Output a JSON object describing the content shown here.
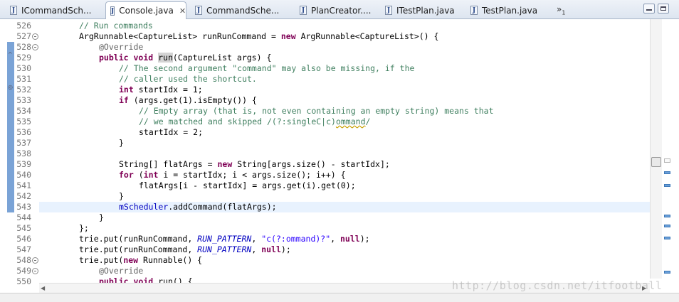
{
  "tabs": [
    {
      "label": "ICommandSch...",
      "icon": "java-file-icon",
      "active": false
    },
    {
      "label": "Console.java",
      "icon": "java-file-icon",
      "active": true
    },
    {
      "label": "CommandSche...",
      "icon": "java-file-icon",
      "active": false
    },
    {
      "label": "PlanCreator....",
      "icon": "java-file-icon",
      "active": false
    },
    {
      "label": "ITestPlan.java",
      "icon": "java-file-icon",
      "active": false
    },
    {
      "label": "TestPlan.java",
      "icon": "java-file-icon",
      "active": false
    }
  ],
  "overflow": {
    "label": "»",
    "count": "1"
  },
  "close_glyph": "✕",
  "line_numbers": [
    "526",
    "527",
    "528",
    "529",
    "530",
    "531",
    "532",
    "533",
    "534",
    "535",
    "536",
    "537",
    "538",
    "539",
    "540",
    "541",
    "542",
    "543",
    "544",
    "545",
    "546",
    "547",
    "548",
    "549",
    "550"
  ],
  "code": {
    "l526": "// Run commands",
    "l527": [
      "ArgRunnable<CaptureList> runRunCommand = ",
      "new",
      " ArgRunnable<CaptureList>() {"
    ],
    "l528": "@Override",
    "l529": [
      "public",
      "void",
      "run",
      "(CaptureList args) {"
    ],
    "l530": "// The second argument \"command\" may also be missing, if the",
    "l531": "// caller used the shortcut.",
    "l532": [
      "int",
      " startIdx = 1;"
    ],
    "l533": [
      "if",
      " (args.get(1).isEmpty()) {"
    ],
    "l534": "// Empty array (that is, not even containing an empty string) means that",
    "l535": [
      "// we matched and skipped /(?:singleC|c)",
      "ommand",
      "/"
    ],
    "l536": "startIdx = 2;",
    "l537": "}",
    "l539": [
      "String[] flatArgs = ",
      "new",
      " String[args.size() - startIdx];"
    ],
    "l540": [
      "for",
      " (",
      "int",
      " i = startIdx; i < args.size(); i++) {"
    ],
    "l541": "flatArgs[i - startIdx] = args.get(i).get(0);",
    "l542": "}",
    "l543": [
      "mScheduler",
      ".addCommand(flatArgs);"
    ],
    "l544": "}",
    "l545": "};",
    "l546": [
      "trie.put(runRunCommand, ",
      "RUN_PATTERN",
      ", ",
      "\"c(?:ommand)?\"",
      ", ",
      "null",
      ");"
    ],
    "l547": [
      "trie.put(runRunCommand, ",
      "RUN_PATTERN",
      ", ",
      "null",
      ");"
    ],
    "l548": [
      "trie.put(",
      "new",
      " Runnable() {"
    ],
    "l549": "@Override",
    "l550": [
      "public",
      "void",
      "run() {"
    ]
  },
  "watermark": "http://blog.csdn.net/itfootball",
  "colors": {
    "keyword": "#7f0055",
    "comment": "#3f7f5f",
    "string": "#2a00ff",
    "annotation": "#646464",
    "field": "#0000c0",
    "current_line": "#e8f2fe",
    "change_bar": "#7aa3d6"
  }
}
